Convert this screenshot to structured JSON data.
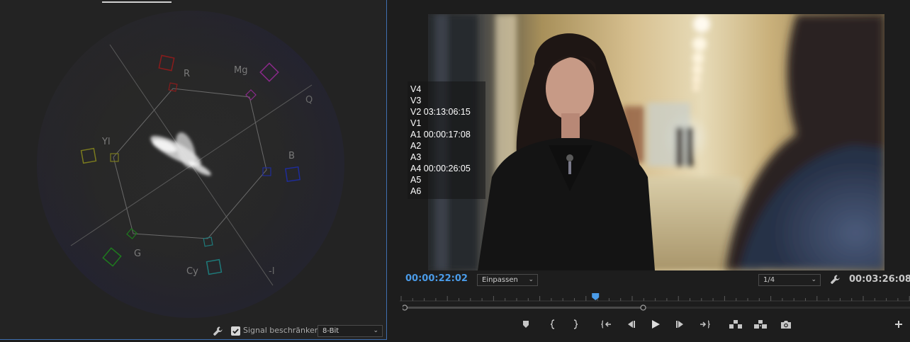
{
  "scopes": {
    "vectorscope_labels": {
      "r": "R",
      "mg": "Mg",
      "q": "Q",
      "yl": "Yl",
      "b": "B",
      "g": "G",
      "cy": "Cy",
      "minus_i": "-I"
    },
    "footer": {
      "signal_label": "Signal beschränken",
      "signal_checked": true,
      "bitdepth_value": "8-Bit"
    }
  },
  "monitor": {
    "overlay_lines": [
      "V4",
      "V3",
      "V2 03:13:06:15",
      "V1",
      "A1 00:00:17:08",
      "A2",
      "A3",
      "A4 00:00:26:05",
      "A5",
      "A6"
    ],
    "current_timecode": "00:00:22:02",
    "fit_value": "Einpassen",
    "quality_value": "1/4",
    "duration_timecode": "00:03:26:08",
    "playhead_fraction": 0.383,
    "work_in_fraction": 0.0,
    "work_out_fraction": 0.474
  },
  "icons": {
    "wrench": "wrench-icon",
    "add_marker": "marker-icon",
    "mark_in": "mark-in-icon",
    "mark_out": "mark-out-icon",
    "go_to_in": "go-to-in-icon",
    "step_back": "step-back-icon",
    "play": "play-icon",
    "step_forward": "step-forward-icon",
    "go_to_out": "go-to-out-icon",
    "lift": "lift-icon",
    "extract": "extract-icon",
    "export_frame": "camera-icon",
    "add_button": "plus-icon"
  },
  "colors": {
    "accent_blue": "#4a9be8",
    "panel_border": "#3f6fb0"
  }
}
